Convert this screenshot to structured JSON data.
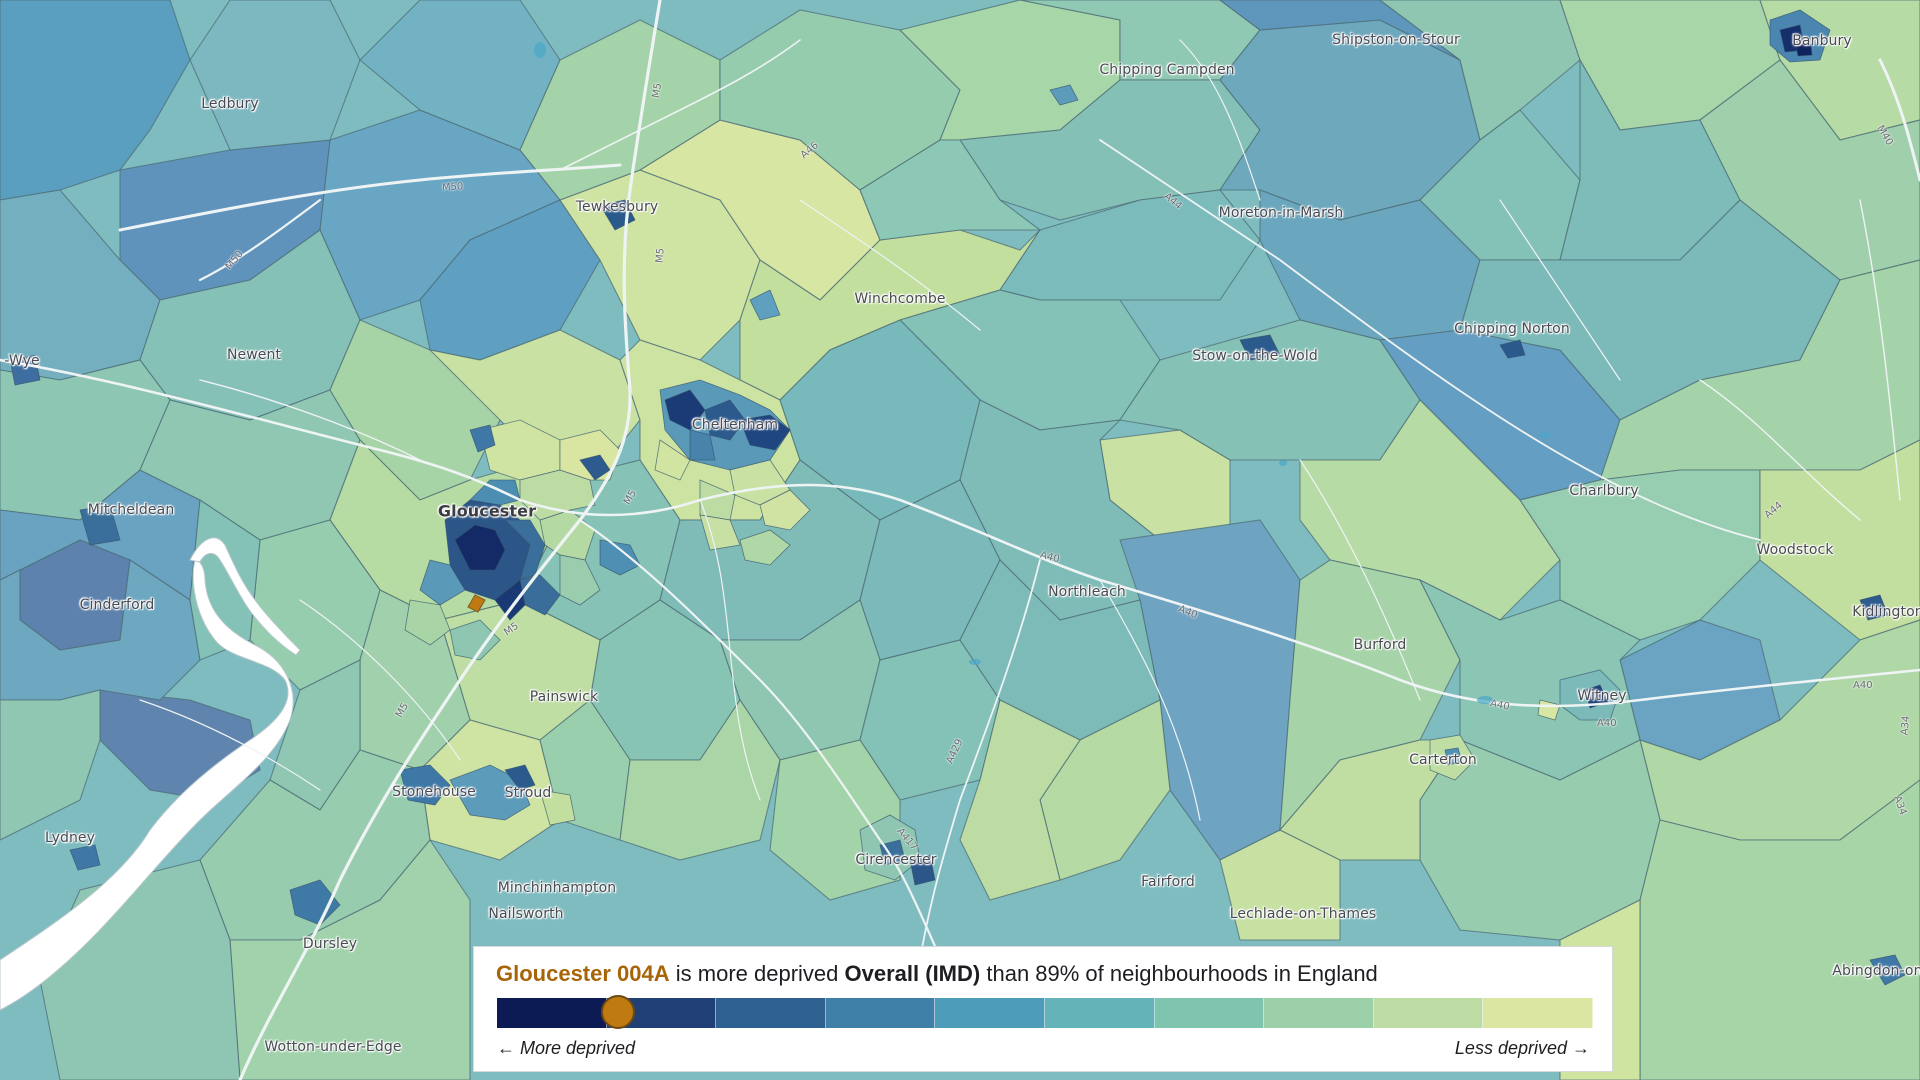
{
  "map": {
    "colors": {
      "deprivation_scale": [
        "#0d1b55",
        "#1f3f75",
        "#2f6190",
        "#3f80a8",
        "#4e9db8",
        "#64b3b8",
        "#7ec4ae",
        "#9bd0a8",
        "#bcdca4",
        "#dbe6a2"
      ],
      "selected_area": "#c07a12",
      "estuary": "#ffffff",
      "roads": "#eef3f4"
    },
    "place_labels": [
      "Shipston-on-Stour",
      "Banbury",
      "Chipping Campden",
      "Ledbury",
      "Tewkesbury",
      "Moreton-in-Marsh",
      "Winchcombe",
      "Chipping Norton",
      "Newent",
      "Stow-on-the-Wold",
      "Cheltenham",
      "Gloucester",
      "Mitcheldean",
      "Charlbury",
      "Woodstock",
      "Cinderford",
      "Northleach",
      "Kidlington",
      "Burford",
      "Witney",
      "Painswick",
      "Carterton",
      "Stonehouse",
      "Stroud",
      "Lydney",
      "Minchinhampton",
      "Cirencester",
      "Fairford",
      "Lechlade-on-Thames",
      "Nailsworth",
      "Dursley",
      "Abingdon-on-",
      "Wotton-under-Edge",
      "-Wye"
    ],
    "road_labels": [
      "M5",
      "A46",
      "M50",
      "M50",
      "A44",
      "M40",
      "A40",
      "A40",
      "A40",
      "A40",
      "A429",
      "A417",
      "A34",
      "A34",
      "A44",
      "M5",
      "M5",
      "M5",
      "M5",
      "A40"
    ]
  },
  "legend": {
    "area_name": "Gloucester 004A",
    "text_before_measure": "is more deprived",
    "measure": "Overall (IMD)",
    "text_after_measure": "than 89% of neighbourhoods in England",
    "more_label": "← More deprived",
    "less_label": "Less deprived →",
    "marker_decile": 2,
    "marker_percent_more_deprived_than": 89
  }
}
